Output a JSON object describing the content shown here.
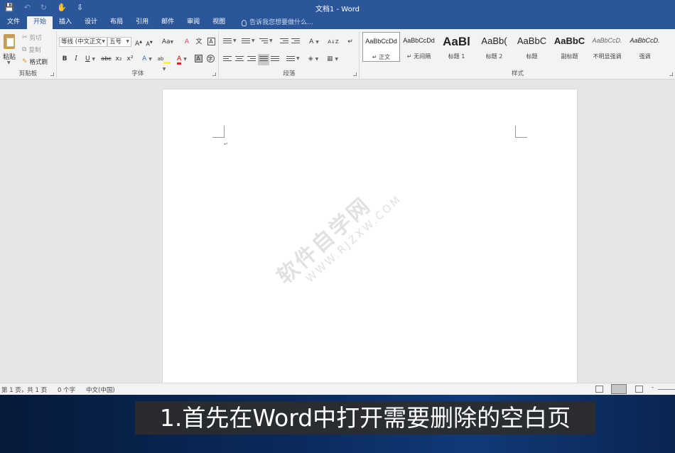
{
  "titlebar": {
    "title": "文档1 - Word",
    "qat": {
      "save_icon": "💾",
      "undo_icon": "↶",
      "redo_icon": "↻",
      "touch_icon": "✋",
      "customize_icon": "⇩"
    }
  },
  "tabs": [
    "文件",
    "开始",
    "插入",
    "设计",
    "布局",
    "引用",
    "邮件",
    "审阅",
    "视图"
  ],
  "tell_me": "告诉我您想要做什么...",
  "clipboard": {
    "paste": "粘贴",
    "cut": "剪切",
    "copy": "复制",
    "format_painter": "格式刷",
    "label": "剪贴板"
  },
  "font": {
    "name": "等线 (中文正文",
    "size": "五号",
    "grow": "A",
    "shrink": "A",
    "case": "Aa",
    "clear": "A",
    "phonetic": "文",
    "border": "A",
    "bold": "B",
    "italic": "I",
    "underline": "U",
    "strike": "abc",
    "subscript": "x₂",
    "superscript": "x²",
    "effects": "A",
    "highlight": "ab",
    "color": "A",
    "shading": "A",
    "enclose": "字",
    "label": "字体"
  },
  "paragraph": {
    "label": "段落",
    "asian_layout": "A",
    "sort": "A↓Z",
    "show_marks": "↵"
  },
  "styles": {
    "label": "样式",
    "items": [
      {
        "sample": "AaBbCcDd",
        "name": "↵ 正文"
      },
      {
        "sample": "AaBbCcDd",
        "name": "↵ 无间隔"
      },
      {
        "sample": "AaBl",
        "name": "标题 1"
      },
      {
        "sample": "AaBb(",
        "name": "标题 2"
      },
      {
        "sample": "AaBbC",
        "name": "标题"
      },
      {
        "sample": "AaBbC",
        "name": "副标题"
      },
      {
        "sample": "AaBbCcD.",
        "name": "不明显强调"
      },
      {
        "sample": "AaBbCcD.",
        "name": "强调"
      }
    ]
  },
  "document": {
    "para_mark": "↵",
    "watermark_main": "软件自学网",
    "watermark_sub": "WWW.RJZXW.COM"
  },
  "status": {
    "page": "第 1 页，共 1 页",
    "words": "0 个字",
    "language": "中文(中国)",
    "zoom_minus": "-"
  },
  "caption": "1.首先在Word中打开需要删除的空白页"
}
